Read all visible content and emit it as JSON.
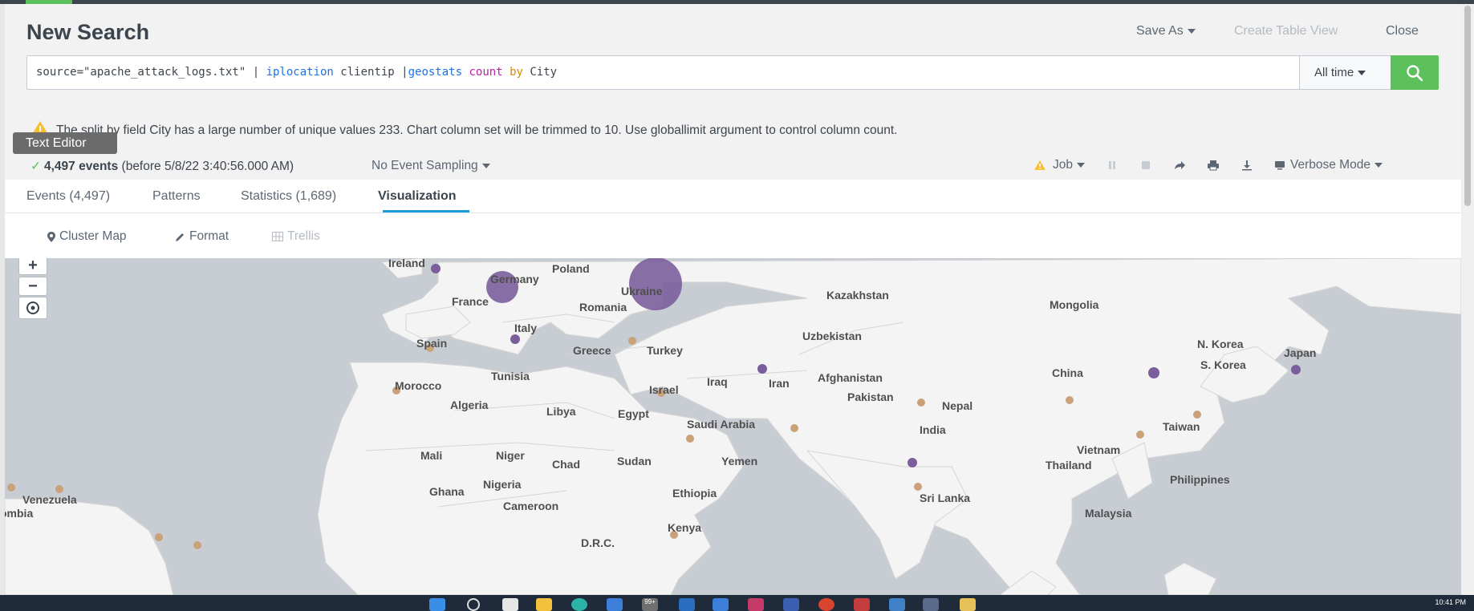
{
  "header": {
    "title": "New Search",
    "save_as": "Save As",
    "create_table_view": "Create Table View",
    "close": "Close"
  },
  "search": {
    "part1": "source=\"apache_attack_logs.txt\" | ",
    "cmd_iplocation": "iplocation",
    "part2": " clientip |",
    "cmd_geostats": "geostats",
    "part3": " ",
    "fn_count": "count",
    "part4": " ",
    "kw_by": "by",
    "part5": " City",
    "time_range": "All time"
  },
  "warning": {
    "text": "The split by field City has a large number of unique values 233. Chart column set will be trimmed to 10. Use globallimit argument to control column count."
  },
  "tooltip": "Text Editor",
  "status": {
    "count": "4,497 events",
    "before": "(before 5/8/22 3:40:56.000 AM)",
    "sampling": "No Event Sampling",
    "job": "Job",
    "mode": "Verbose Mode"
  },
  "tabs": [
    {
      "label": "Events (4,497)"
    },
    {
      "label": "Patterns"
    },
    {
      "label": "Statistics (1,689)"
    },
    {
      "label": "Visualization"
    }
  ],
  "viz_toolbar": {
    "cluster_map": "Cluster Map",
    "format": "Format",
    "trellis": "Trellis"
  },
  "map": {
    "zoom_in": "+",
    "zoom_out": "−",
    "countries": [
      "Ireland",
      "Germany",
      "Poland",
      "Ukraine",
      "France",
      "Romania",
      "Kazakhstan",
      "Mongolia",
      "Italy",
      "Spain",
      "Greece",
      "Turkey",
      "Uzbekistan",
      "N. Korea",
      "Japan",
      "S. Korea",
      "China",
      "Tunisia",
      "Morocco",
      "Iraq",
      "Israel",
      "Iran",
      "Afghanistan",
      "Pakistan",
      "Nepal",
      "Algeria",
      "Libya",
      "Egypt",
      "Saudi Arabia",
      "India",
      "Taiwan",
      "Mali",
      "Niger",
      "Chad",
      "Sudan",
      "Yemen",
      "Vietnam",
      "Thailand",
      "Philippines",
      "Venezuela",
      "Ghana",
      "Nigeria",
      "Ethiopia",
      "Sri Lanka",
      "Cameroon",
      "Malaysia",
      "ombia",
      "Kenya",
      "D.R.C."
    ],
    "colors": {
      "purple": "#7b5f9c",
      "tan": "#c9a27a",
      "water": "#c8ccd3",
      "land": "#f4f4f4"
    }
  },
  "taskbar": {
    "clock": "10:41 PM",
    "badge": "99+"
  }
}
